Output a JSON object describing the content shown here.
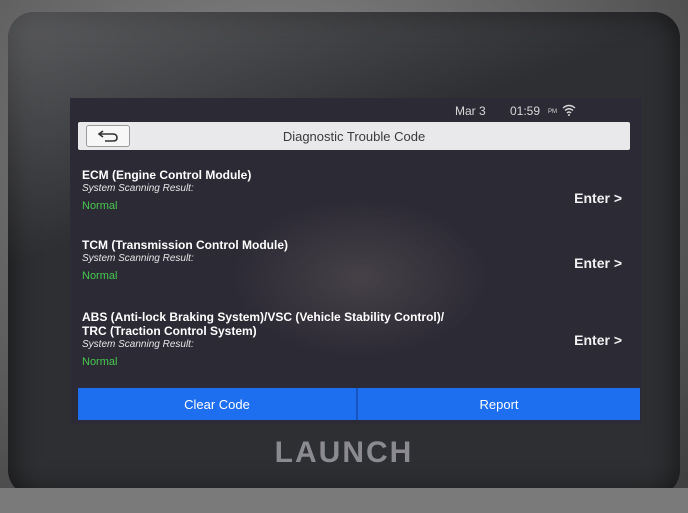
{
  "status": {
    "date": "Mar 3",
    "time": "01:59",
    "ampm": "PM"
  },
  "header": {
    "title": "Diagnostic Trouble Code"
  },
  "modules": [
    {
      "name_line1": "ECM (Engine Control Module)",
      "name_line2": "",
      "result_label": "System Scanning Result:",
      "result": "Normal",
      "enter": "Enter >"
    },
    {
      "name_line1": "TCM (Transmission Control Module)",
      "name_line2": "",
      "result_label": "System Scanning Result:",
      "result": "Normal",
      "enter": "Enter >"
    },
    {
      "name_line1": "ABS (Anti-lock Braking System)/VSC (Vehicle Stability Control)/",
      "name_line2": "TRC (Traction Control System)",
      "result_label": "System Scanning Result:",
      "result": "Normal",
      "enter": "Enter >"
    }
  ],
  "footer": {
    "clear_label": "Clear Code",
    "report_label": "Report"
  },
  "brand": "LAUNCH",
  "icons": {
    "back": "back-arrow-icon",
    "wifi": "wifi-icon"
  },
  "colors": {
    "accent": "#1e6ef0",
    "status_ok": "#46c84e"
  }
}
